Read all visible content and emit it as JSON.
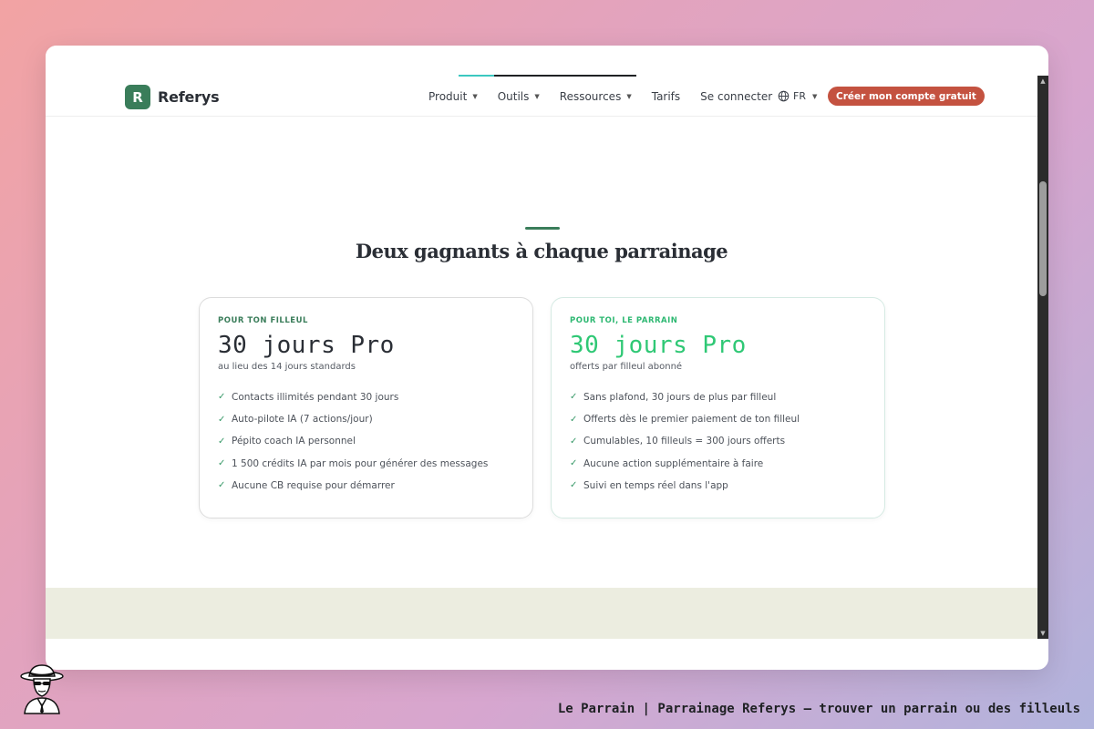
{
  "header": {
    "brand": "Referys",
    "brand_initial": "R",
    "progress_fraction": 0.2,
    "nav": [
      {
        "label": "Produit",
        "has_dropdown": true
      },
      {
        "label": "Outils",
        "has_dropdown": true
      },
      {
        "label": "Ressources",
        "has_dropdown": true
      },
      {
        "label": "Tarifs",
        "has_dropdown": false
      },
      {
        "label": "Se connecter",
        "has_dropdown": false
      }
    ],
    "language": "FR",
    "cta": "Créer mon compte gratuit"
  },
  "section": {
    "title": "Deux gagnants à chaque parrainage"
  },
  "cards": {
    "filleul": {
      "label": "POUR TON FILLEUL",
      "headline": "30 jours Pro",
      "subtitle": "au lieu des 14 jours standards",
      "features": [
        "Contacts illimités pendant 30 jours",
        "Auto-pilote IA (7 actions/jour)",
        "Pépito coach IA personnel",
        "1 500 crédits IA par mois pour générer des messages",
        "Aucune CB requise pour démarrer"
      ]
    },
    "parrain": {
      "label": "POUR TOI, LE PARRAIN",
      "headline": "30 jours Pro",
      "subtitle": "offerts par filleul abonné",
      "features": [
        "Sans plafond, 30 jours de plus par filleul",
        "Offerts dès le premier paiement de ton filleul",
        "Cumulables, 10 filleuls = 300 jours offerts",
        "Aucune action supplémentaire à faire",
        "Suivi en temps réel dans l'app"
      ]
    }
  },
  "icons": {
    "check": "✓",
    "caret": "▼",
    "globe": "globe-icon"
  },
  "footer": {
    "caption": "Le Parrain | Parrainage Referys — trouver un parrain ou des filleuls"
  },
  "colors": {
    "brand_green": "#3a7d5a",
    "accent_green": "#2fc875",
    "cta_red": "#c45240",
    "band": "#ecede0"
  }
}
